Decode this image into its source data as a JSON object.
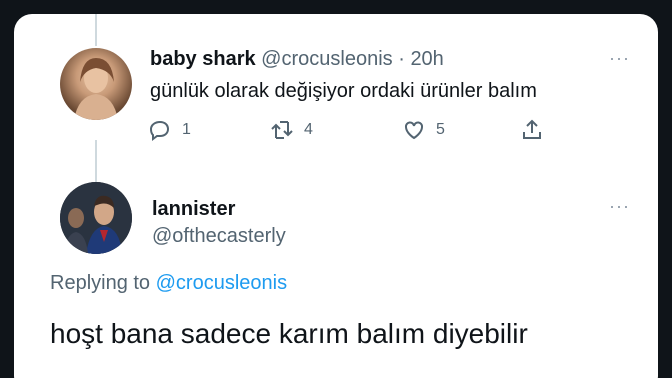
{
  "tweet1": {
    "display_name": "baby shark",
    "handle": "@crocusleonis",
    "separator": "·",
    "time": "20h",
    "text": "günlük olarak değişiyor ordaki ürünler balım",
    "more": "···",
    "reply_count": "1",
    "retweet_count": "4",
    "like_count": "5",
    "icons": {
      "reply": "reply-icon",
      "retweet": "retweet-icon",
      "like": "heart-icon",
      "share": "share-icon"
    }
  },
  "tweet2": {
    "display_name": "lannister",
    "handle": "@ofthecasterly",
    "more": "···",
    "replying_prefix": "Replying to",
    "replying_to": "@crocusleonis",
    "text": "hoşt bana sadece karım balım diyebilir"
  },
  "colors": {
    "background": "#0f1419",
    "card": "#ffffff",
    "primary_text": "#0f1419",
    "secondary_text": "#536471",
    "accent": "#1d9bf0"
  }
}
